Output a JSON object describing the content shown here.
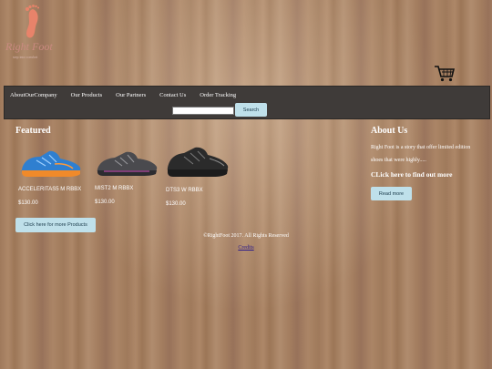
{
  "logo": {
    "brand": "Right Foot",
    "tagline": "step into comfort"
  },
  "header": {
    "cart_icon": "shopping-cart-icon"
  },
  "nav": {
    "items": [
      {
        "label": "AboutOurCompany"
      },
      {
        "label": "Our Products"
      },
      {
        "label": "Our Partners"
      },
      {
        "label": "Contact Us"
      },
      {
        "label": "Order Tracking"
      }
    ]
  },
  "search": {
    "value": "",
    "placeholder": "",
    "button_label": "Search"
  },
  "featured": {
    "title": "Featured",
    "products": [
      {
        "name": "ACCELERITAS5 M RBBX",
        "price": "$130.00",
        "color": "#2f7fd0"
      },
      {
        "name": "MIST2 M RBBX",
        "price": "$130.00",
        "color": "#4a4a4e"
      },
      {
        "name": "DTS3 W RBBX",
        "price": "$130.00",
        "color": "#2b2b2b"
      }
    ],
    "more_button": "Click here for more Products"
  },
  "about": {
    "title": "About Us",
    "text": "Right Foot is a story that offer limited edition shoes that were highly.....",
    "link": "CLick here to find out more",
    "button": "Read more"
  },
  "footer": {
    "copyright": "©RightFoot 2017. All Rights Reserved",
    "credits": "Credits"
  },
  "colors": {
    "nav_bg": "#3f3b39",
    "button_bg": "#bfe0ea",
    "accent_logo": "#e8836a"
  }
}
